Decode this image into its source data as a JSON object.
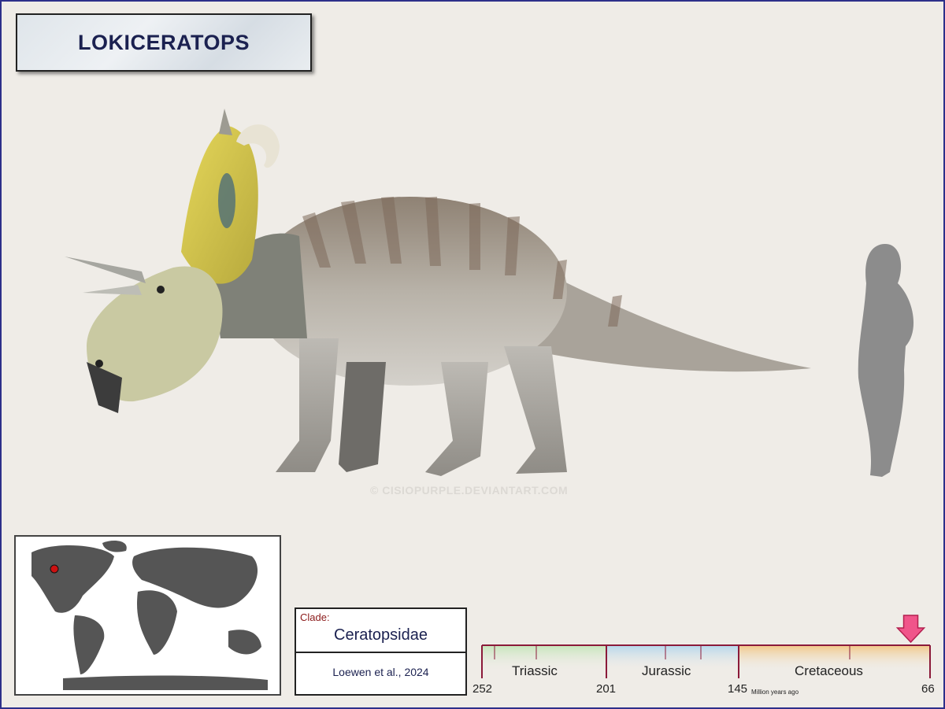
{
  "title": "LOKICERATOPS",
  "watermark": "© CISIOPURPLE.DEVIANTART.COM",
  "clade": {
    "label": "Clade:",
    "name": "Ceratopsidae",
    "reference": "Loewen et al., 2024"
  },
  "timeline": {
    "periods": [
      "Triassic",
      "Jurassic",
      "Cretaceous"
    ],
    "ticks": [
      "252",
      "201",
      "145",
      "66"
    ],
    "unit": "Million years ago",
    "marker_mya": 74
  },
  "colors": {
    "frame": "#2d2f8a",
    "title_text": "#1b2150",
    "triassic": "#c8e6bd",
    "jurassic": "#b8d8ec",
    "cretaceous": "#f2c98b",
    "timeline_axis": "#8b1a3a",
    "marker": "#f0558a",
    "locality_dot": "#cc1111"
  },
  "icons": {
    "human": "human-silhouette-icon",
    "marker": "down-arrow-icon"
  }
}
